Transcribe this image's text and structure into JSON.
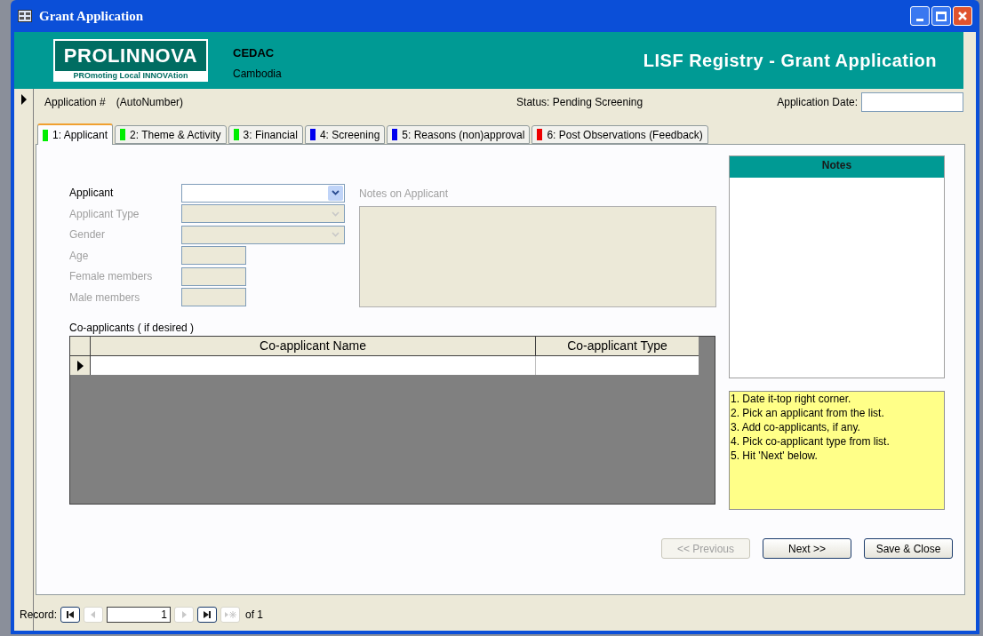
{
  "window": {
    "title": "Grant Application"
  },
  "header": {
    "logo_name": "PROLINNOVA",
    "logo_tagline": "PROmoting Local INNOVAtion",
    "organization": "CEDAC",
    "country": "Cambodia",
    "title": "LISF Registry - Grant Application"
  },
  "record_info": {
    "number_label": "Application #",
    "number_value": "(AutoNumber)",
    "status": "Status: Pending Screening",
    "date_label": "Application Date:"
  },
  "tabs": [
    {
      "label": "1: Applicant",
      "color": "#00ee00",
      "selected": true
    },
    {
      "label": "2: Theme & Activity",
      "color": "#00ee00",
      "selected": false
    },
    {
      "label": "3: Financial",
      "color": "#00ee00",
      "selected": false
    },
    {
      "label": "4: Screening",
      "color": "#0000ee",
      "selected": false
    },
    {
      "label": "5: Reasons (non)approval",
      "color": "#0000ee",
      "selected": false
    },
    {
      "label": "6: Post Observations (Feedback)",
      "color": "#ee0000",
      "selected": false
    }
  ],
  "applicant_fields": [
    {
      "label": "Applicant",
      "kind": "combo",
      "disabled": false
    },
    {
      "label": "Applicant Type",
      "kind": "combo",
      "disabled": true
    },
    {
      "label": "Gender",
      "kind": "combo",
      "disabled": true
    },
    {
      "label": "Age",
      "kind": "text",
      "disabled": true
    },
    {
      "label": "Female members",
      "kind": "text",
      "disabled": true
    },
    {
      "label": "Male members",
      "kind": "text",
      "disabled": true
    }
  ],
  "notes_on_applicant": {
    "label": "Notes on Applicant",
    "disabled": true
  },
  "coapplicants": {
    "label": "Co-applicants ( if desired )",
    "columns": [
      "Co-applicant Name",
      "Co-applicant Type"
    ]
  },
  "notes": {
    "title": "Notes",
    "instructions": [
      "1. Date it-top right corner.",
      "2. Pick an applicant from the list.",
      "3. Add co-applicants, if any.",
      "4. Pick co-applicant type from list.",
      "5. Hit 'Next' below."
    ]
  },
  "buttons": [
    {
      "label": "<< Previous",
      "disabled": true
    },
    {
      "label": "Next >>",
      "disabled": false
    },
    {
      "label": "Save & Close",
      "disabled": false
    }
  ],
  "navigation": {
    "label": "Record:",
    "current": "1",
    "total": "of 1",
    "first_disabled": false,
    "prev_disabled": true,
    "next_disabled": true,
    "last_disabled": false,
    "new_disabled": true
  }
}
